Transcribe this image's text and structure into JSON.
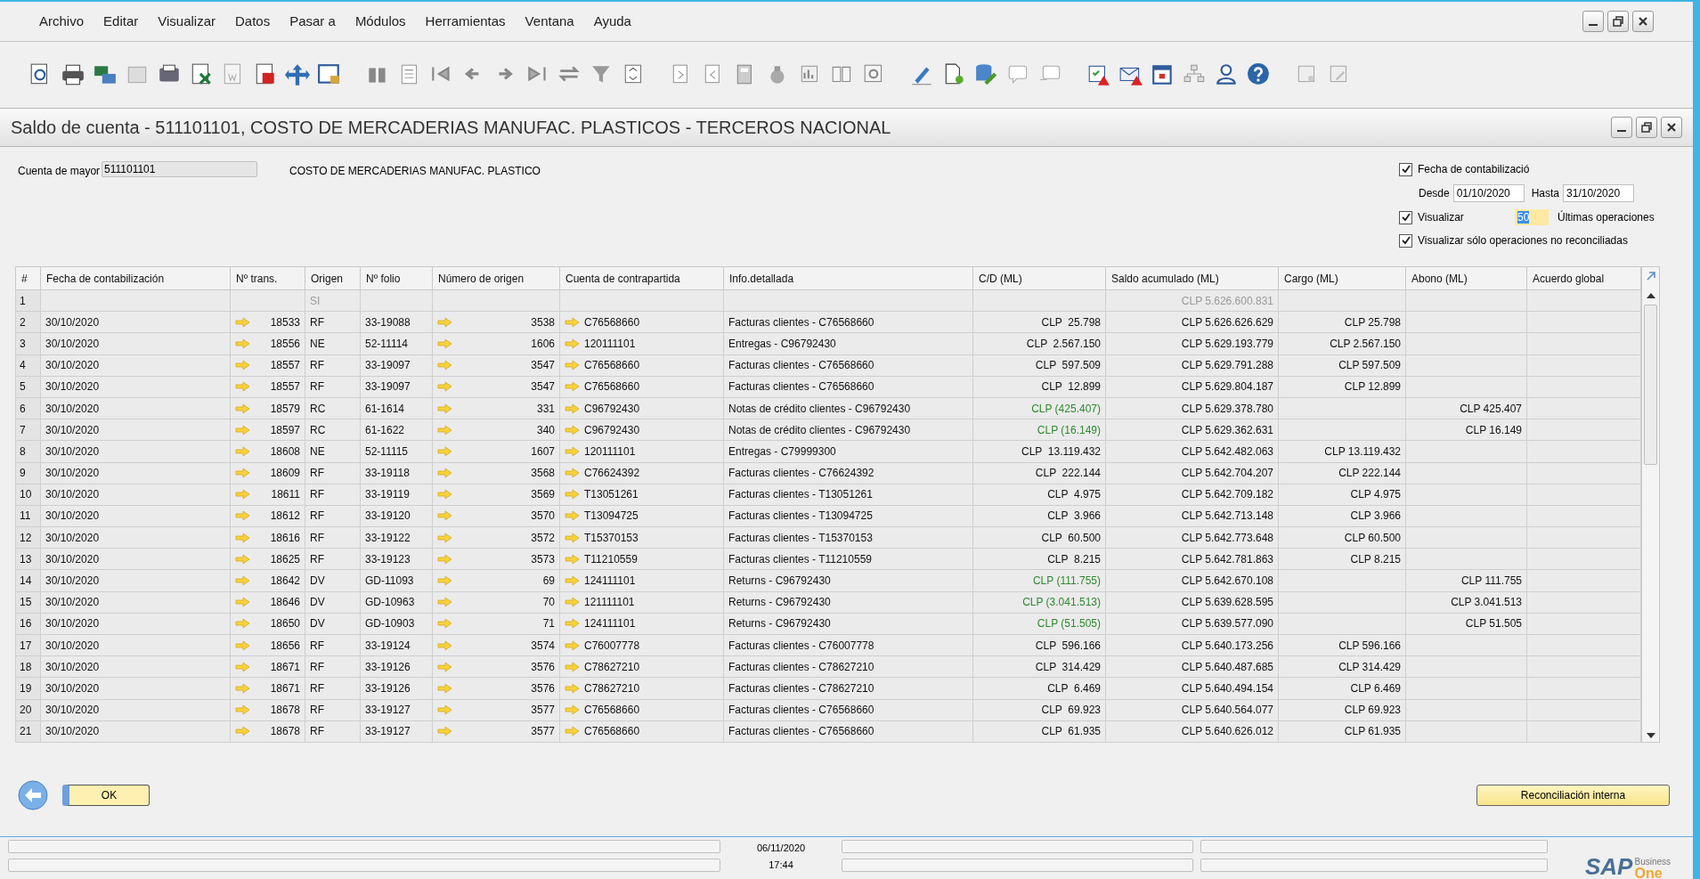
{
  "menu": [
    "Archivo",
    "Editar",
    "Visualizar",
    "Datos",
    "Pasar a",
    "Módulos",
    "Herramientas",
    "Ventana",
    "Ayuda"
  ],
  "window": {
    "title": "Saldo de cuenta - 511101101, COSTO DE MERCADERIAS MANUFAC. PLASTICOS - TERCEROS NACIONAL"
  },
  "account": {
    "label": "Cuenta de mayor",
    "value": "511101101",
    "description": "COSTO DE MERCADERIAS MANUFAC. PLASTICO"
  },
  "filters": {
    "posting_date": {
      "label": "Fecha de contabilizació",
      "checked": true
    },
    "from_label": "Desde",
    "from": "01/10/2020",
    "to_label": "Hasta",
    "to": "31/10/2020",
    "show_last": {
      "label": "Visualizar",
      "checked": true,
      "value": "50",
      "suffix": "Últimas operaciones"
    },
    "only_unreconciled": {
      "label": "Visualizar sólo operaciones no reconciliadas",
      "checked": true
    }
  },
  "table": {
    "columns": [
      "#",
      "Fecha de contabilización",
      "Nº trans.",
      "Origen",
      "Nº folio",
      "Número de origen",
      "Cuenta de contrapartida",
      "Info.detallada",
      "C/D (ML)",
      "Saldo acumulado (ML)",
      "Cargo (ML)",
      "Abono (ML)",
      "Acuerdo global"
    ],
    "rows": [
      {
        "kind": "opening",
        "num": "1",
        "date": "",
        "trans": "",
        "origin": "SI",
        "folio": "",
        "source": "",
        "account": "",
        "info": "",
        "cd": "",
        "balance": "CLP 5.626.600.831",
        "debit": "",
        "credit": ""
      },
      {
        "kind": "entry",
        "num": "2",
        "date": "30/10/2020",
        "trans": "18533",
        "origin": "RF",
        "folio": "33-19088",
        "source": "3538",
        "account": "C76568660",
        "info": "Facturas clientes - C76568660",
        "cd": "CLP  25.798",
        "cd_credit": false,
        "balance": "CLP 5.626.626.629",
        "debit": "CLP 25.798",
        "credit": ""
      },
      {
        "kind": "entry",
        "num": "3",
        "date": "30/10/2020",
        "trans": "18556",
        "origin": "NE",
        "folio": "52-11114",
        "source": "1606",
        "account": "120111101",
        "info": "Entregas - C96792430",
        "cd": "CLP  2.567.150",
        "cd_credit": false,
        "balance": "CLP 5.629.193.779",
        "debit": "CLP 2.567.150",
        "credit": ""
      },
      {
        "kind": "entry",
        "num": "4",
        "date": "30/10/2020",
        "trans": "18557",
        "origin": "RF",
        "folio": "33-19097",
        "source": "3547",
        "account": "C76568660",
        "info": "Facturas clientes - C76568660",
        "cd": "CLP  597.509",
        "cd_credit": false,
        "balance": "CLP 5.629.791.288",
        "debit": "CLP 597.509",
        "credit": ""
      },
      {
        "kind": "entry",
        "num": "5",
        "date": "30/10/2020",
        "trans": "18557",
        "origin": "RF",
        "folio": "33-19097",
        "source": "3547",
        "account": "C76568660",
        "info": "Facturas clientes - C76568660",
        "cd": "CLP  12.899",
        "cd_credit": false,
        "balance": "CLP 5.629.804.187",
        "debit": "CLP 12.899",
        "credit": ""
      },
      {
        "kind": "entry",
        "num": "6",
        "date": "30/10/2020",
        "trans": "18579",
        "origin": "RC",
        "folio": "61-1614",
        "source": "331",
        "account": "C96792430",
        "info": "Notas de crédito clientes - C96792430",
        "cd": "CLP (425.407)",
        "cd_credit": true,
        "balance": "CLP 5.629.378.780",
        "debit": "",
        "credit": "CLP 425.407"
      },
      {
        "kind": "entry",
        "num": "7",
        "date": "30/10/2020",
        "trans": "18597",
        "origin": "RC",
        "folio": "61-1622",
        "source": "340",
        "account": "C96792430",
        "info": "Notas de crédito clientes - C96792430",
        "cd": "CLP (16.149)",
        "cd_credit": true,
        "balance": "CLP 5.629.362.631",
        "debit": "",
        "credit": "CLP 16.149"
      },
      {
        "kind": "entry",
        "num": "8",
        "date": "30/10/2020",
        "trans": "18608",
        "origin": "NE",
        "folio": "52-11115",
        "source": "1607",
        "account": "120111101",
        "info": "Entregas - C79999300",
        "cd": "CLP  13.119.432",
        "cd_credit": false,
        "balance": "CLP 5.642.482.063",
        "debit": "CLP 13.119.432",
        "credit": ""
      },
      {
        "kind": "entry",
        "num": "9",
        "date": "30/10/2020",
        "trans": "18609",
        "origin": "RF",
        "folio": "33-19118",
        "source": "3568",
        "account": "C76624392",
        "info": "Facturas clientes - C76624392",
        "cd": "CLP  222.144",
        "cd_credit": false,
        "balance": "CLP 5.642.704.207",
        "debit": "CLP 222.144",
        "credit": ""
      },
      {
        "kind": "entry",
        "num": "10",
        "date": "30/10/2020",
        "trans": "18611",
        "origin": "RF",
        "folio": "33-19119",
        "source": "3569",
        "account": "T13051261",
        "info": "Facturas clientes - T13051261",
        "cd": "CLP  4.975",
        "cd_credit": false,
        "balance": "CLP 5.642.709.182",
        "debit": "CLP 4.975",
        "credit": ""
      },
      {
        "kind": "entry",
        "num": "11",
        "date": "30/10/2020",
        "trans": "18612",
        "origin": "RF",
        "folio": "33-19120",
        "source": "3570",
        "account": "T13094725",
        "info": "Facturas clientes - T13094725",
        "cd": "CLP  3.966",
        "cd_credit": false,
        "balance": "CLP 5.642.713.148",
        "debit": "CLP 3.966",
        "credit": ""
      },
      {
        "kind": "entry",
        "num": "12",
        "date": "30/10/2020",
        "trans": "18616",
        "origin": "RF",
        "folio": "33-19122",
        "source": "3572",
        "account": "T15370153",
        "info": "Facturas clientes - T15370153",
        "cd": "CLP  60.500",
        "cd_credit": false,
        "balance": "CLP 5.642.773.648",
        "debit": "CLP 60.500",
        "credit": ""
      },
      {
        "kind": "entry",
        "num": "13",
        "date": "30/10/2020",
        "trans": "18625",
        "origin": "RF",
        "folio": "33-19123",
        "source": "3573",
        "account": "T11210559",
        "info": "Facturas clientes - T11210559",
        "cd": "CLP  8.215",
        "cd_credit": false,
        "balance": "CLP 5.642.781.863",
        "debit": "CLP 8.215",
        "credit": ""
      },
      {
        "kind": "entry",
        "num": "14",
        "date": "30/10/2020",
        "trans": "18642",
        "origin": "DV",
        "folio": "GD-11093",
        "source": "69",
        "account": "124111101",
        "info": "Returns - C96792430",
        "cd": "CLP (111.755)",
        "cd_credit": true,
        "balance": "CLP 5.642.670.108",
        "debit": "",
        "credit": "CLP 111.755"
      },
      {
        "kind": "entry",
        "num": "15",
        "date": "30/10/2020",
        "trans": "18646",
        "origin": "DV",
        "folio": "GD-10963",
        "source": "70",
        "account": "121111101",
        "info": "Returns - C96792430",
        "cd": "CLP (3.041.513)",
        "cd_credit": true,
        "balance": "CLP 5.639.628.595",
        "debit": "",
        "credit": "CLP 3.041.513"
      },
      {
        "kind": "entry",
        "num": "16",
        "date": "30/10/2020",
        "trans": "18650",
        "origin": "DV",
        "folio": "GD-10903",
        "source": "71",
        "account": "124111101",
        "info": "Returns - C96792430",
        "cd": "CLP (51.505)",
        "cd_credit": true,
        "balance": "CLP 5.639.577.090",
        "debit": "",
        "credit": "CLP 51.505"
      },
      {
        "kind": "entry",
        "num": "17",
        "date": "30/10/2020",
        "trans": "18656",
        "origin": "RF",
        "folio": "33-19124",
        "source": "3574",
        "account": "C76007778",
        "info": "Facturas clientes - C76007778",
        "cd": "CLP  596.166",
        "cd_credit": false,
        "balance": "CLP 5.640.173.256",
        "debit": "CLP 596.166",
        "credit": ""
      },
      {
        "kind": "entry",
        "num": "18",
        "date": "30/10/2020",
        "trans": "18671",
        "origin": "RF",
        "folio": "33-19126",
        "source": "3576",
        "account": "C78627210",
        "info": "Facturas clientes - C78627210",
        "cd": "CLP  314.429",
        "cd_credit": false,
        "balance": "CLP 5.640.487.685",
        "debit": "CLP 314.429",
        "credit": ""
      },
      {
        "kind": "entry",
        "num": "19",
        "date": "30/10/2020",
        "trans": "18671",
        "origin": "RF",
        "folio": "33-19126",
        "source": "3576",
        "account": "C78627210",
        "info": "Facturas clientes - C78627210",
        "cd": "CLP  6.469",
        "cd_credit": false,
        "balance": "CLP 5.640.494.154",
        "debit": "CLP 6.469",
        "credit": ""
      },
      {
        "kind": "entry",
        "num": "20",
        "date": "30/10/2020",
        "trans": "18678",
        "origin": "RF",
        "folio": "33-19127",
        "source": "3577",
        "account": "C76568660",
        "info": "Facturas clientes - C76568660",
        "cd": "CLP  69.923",
        "cd_credit": false,
        "balance": "CLP 5.640.564.077",
        "debit": "CLP 69.923",
        "credit": ""
      },
      {
        "kind": "entry",
        "num": "21",
        "date": "30/10/2020",
        "trans": "18678",
        "origin": "RF",
        "folio": "33-19127",
        "source": "3577",
        "account": "C76568660",
        "info": "Facturas clientes - C76568660",
        "cd": "CLP  61.935",
        "cd_credit": false,
        "balance": "CLP 5.640.626.012",
        "debit": "CLP 61.935",
        "credit": ""
      }
    ]
  },
  "buttons": {
    "ok": "OK",
    "reconcile": "Reconciliación interna"
  },
  "status_bar": {
    "date": "06/11/2020",
    "time": "17:44"
  },
  "logo": {
    "brand": "SAP",
    "line_1": "Business",
    "line_2": "One"
  }
}
